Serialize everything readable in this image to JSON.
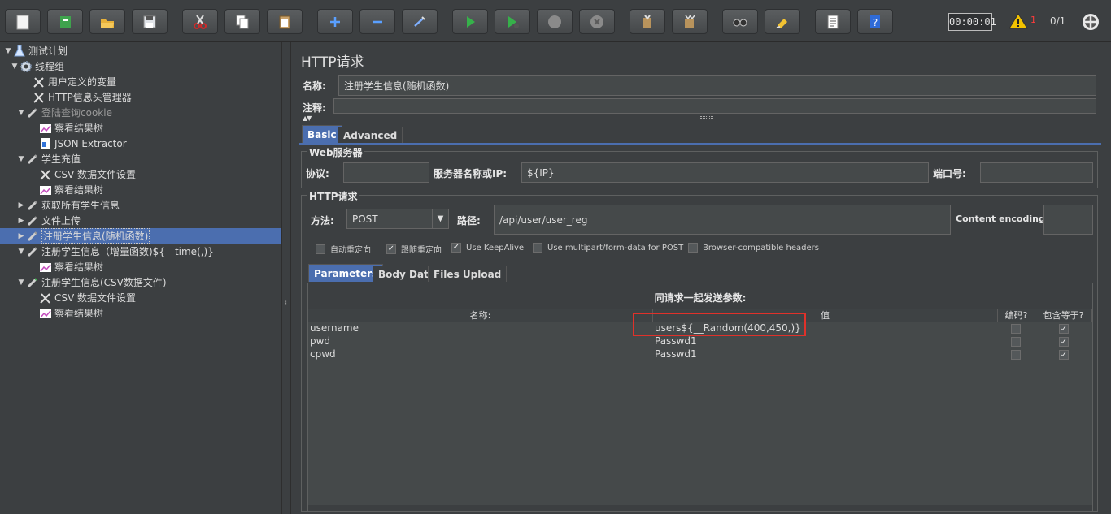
{
  "toolbar": {
    "buttons": [
      "new-icon",
      "templates-icon",
      "open-icon",
      "save-icon",
      "cut-icon",
      "copy-icon",
      "paste-icon",
      "expand-icon",
      "collapse-icon",
      "toggle-icon",
      "start-icon",
      "start-no-pause-icon",
      "stop-icon",
      "shutdown-icon",
      "clear-icon",
      "clear-all-icon",
      "search-icon",
      "reset-search-icon",
      "function-helper-icon",
      "help-icon"
    ],
    "timer": "00:00:01",
    "error_count": "1",
    "threads": "0/1"
  },
  "tree": [
    {
      "label": "测试计划",
      "icon": "flask-icon",
      "arrow": "▼"
    },
    {
      "label": "线程组",
      "icon": "gear-icon",
      "arrow": "▼"
    },
    {
      "label": "用户定义的变量",
      "icon": "wrench-icon",
      "arrow": ""
    },
    {
      "label": "HTTP信息头管理器",
      "icon": "wrench-icon",
      "arrow": ""
    },
    {
      "label": "登陆查询cookie",
      "icon": "pipette-icon",
      "arrow": "▼",
      "dim": true
    },
    {
      "label": "察看结果树",
      "icon": "graph-icon",
      "arrow": ""
    },
    {
      "label": "JSON Extractor",
      "icon": "doc-icon",
      "arrow": ""
    },
    {
      "label": "学生充值",
      "icon": "pipette-icon",
      "arrow": "▼"
    },
    {
      "label": "CSV 数据文件设置",
      "icon": "wrench-icon",
      "arrow": ""
    },
    {
      "label": "察看结果树",
      "icon": "graph-icon",
      "arrow": ""
    },
    {
      "label": "获取所有学生信息",
      "icon": "pipette-icon",
      "arrow": "▶"
    },
    {
      "label": "文件上传",
      "icon": "pipette-icon",
      "arrow": "▶"
    },
    {
      "label": "注册学生信息(随机函数)",
      "icon": "pipette-icon",
      "arrow": "▶",
      "selected": true
    },
    {
      "label": "注册学生信息（增量函数)${__time(,)}",
      "icon": "pipette-icon",
      "arrow": "▼"
    },
    {
      "label": "察看结果树",
      "icon": "graph-icon",
      "arrow": ""
    },
    {
      "label": "注册学生信息(CSV数据文件)",
      "icon": "pipette-green-icon",
      "arrow": "▼"
    },
    {
      "label": "CSV 数据文件设置",
      "icon": "wrench-icon",
      "arrow": ""
    },
    {
      "label": "察看结果树",
      "icon": "graph-icon",
      "arrow": ""
    }
  ],
  "panel": {
    "title": "HTTP请求",
    "name_label": "名称:",
    "name_value": "注册学生信息(随机函数)",
    "comment_label": "注释:",
    "comment_value": "",
    "tabs": [
      "Basic",
      "Advanced"
    ],
    "web_server": {
      "title": "Web服务器",
      "protocol_label": "协议:",
      "protocol_value": "",
      "server_label": "服务器名称或IP:",
      "server_value": "${IP}",
      "port_label": "端口号:",
      "port_value": ""
    },
    "http_request": {
      "title": "HTTP请求",
      "method_label": "方法:",
      "method_value": "POST",
      "path_label": "路径:",
      "path_value": "/api/user/user_reg",
      "encoding_label": "Content encoding:",
      "encoding_value": ""
    },
    "options": [
      {
        "label": "自动重定向",
        "checked": false
      },
      {
        "label": "跟随重定向",
        "checked": true
      },
      {
        "label": "Use KeepAlive",
        "checked": true
      },
      {
        "label": "Use multipart/form-data for POST",
        "checked": false
      },
      {
        "label": "Browser-compatible headers",
        "checked": false
      }
    ],
    "sub_tabs": [
      "Parameters",
      "Body Data",
      "Files Upload"
    ],
    "params_caption": "同请求一起发送参数:",
    "columns": [
      "名称:",
      "值",
      "编码?",
      "包含等于?"
    ],
    "rows": [
      {
        "name": "username",
        "value": "users${__Random(400,450,)}",
        "encode": false,
        "include_equals": true
      },
      {
        "name": "pwd",
        "value": "Passwd1",
        "encode": false,
        "include_equals": true
      },
      {
        "name": "cpwd",
        "value": "Passwd1",
        "encode": false,
        "include_equals": true
      }
    ]
  }
}
